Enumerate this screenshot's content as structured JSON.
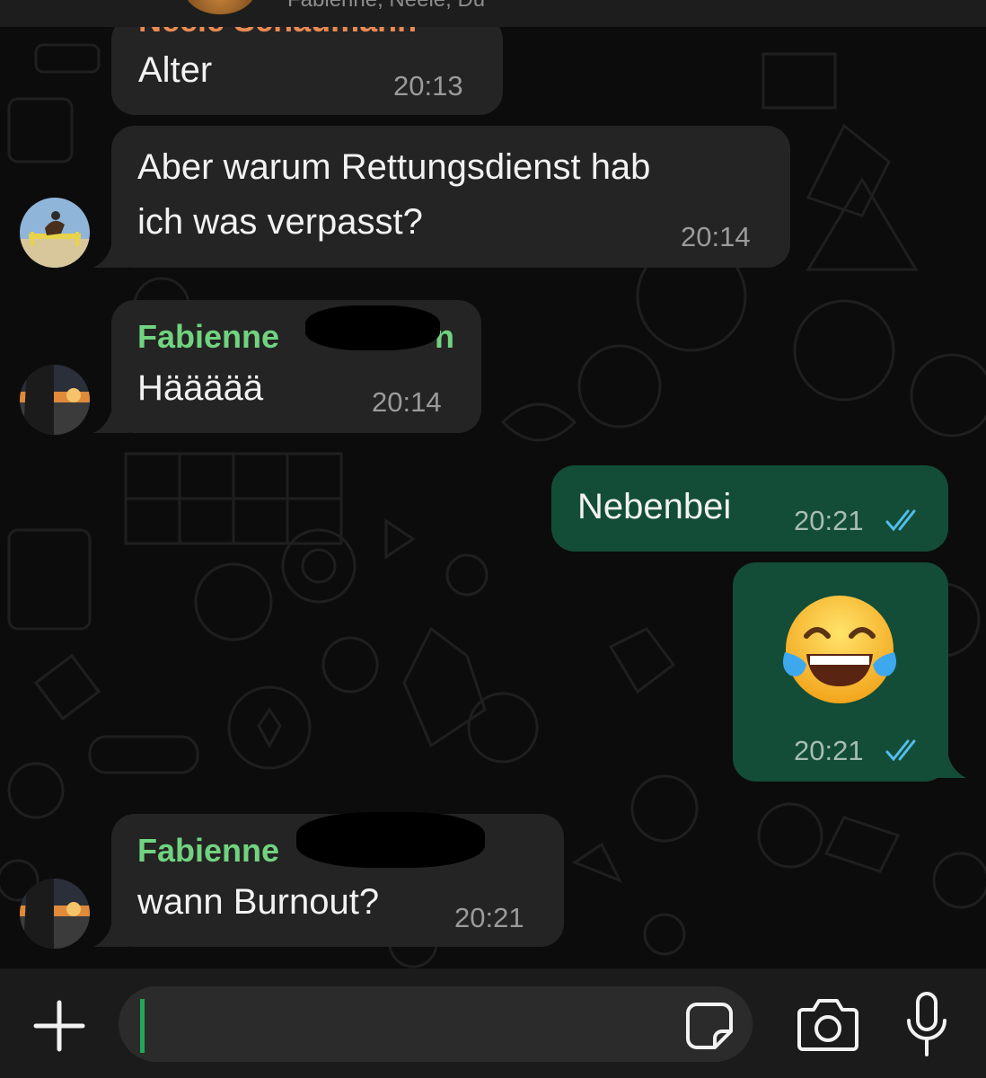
{
  "header": {
    "subtitle": "Fabienne, Neele, Du",
    "avatar_icon": "group-avatar-icon"
  },
  "messages": [
    {
      "direction": "incoming",
      "sender": "Neele Schaumann",
      "text": "Alter",
      "time": "20:13"
    },
    {
      "direction": "incoming",
      "text_line1": "Aber warum Rettungsdienst hab",
      "text_line2": "ich was verpasst?",
      "time": "20:14"
    },
    {
      "direction": "incoming",
      "sender": "Fabienne",
      "sender_tail": "n",
      "text": "Häääää",
      "time": "20:14"
    },
    {
      "direction": "outgoing",
      "text": "Nebenbei",
      "time": "20:21",
      "status": "read"
    },
    {
      "direction": "outgoing",
      "emoji": "😂",
      "emoji_name": "face-with-tears-of-joy",
      "time": "20:21",
      "status": "read"
    },
    {
      "direction": "incoming",
      "sender": "Fabienne",
      "text": "wann Burnout?",
      "time": "20:21"
    }
  ],
  "composer": {
    "value": "",
    "placeholder": "",
    "icons": [
      "plus-icon",
      "sticker-icon",
      "camera-icon",
      "microphone-icon"
    ]
  },
  "colors": {
    "background": "#0c0c0c",
    "incoming_bubble": "#242424",
    "outgoing_bubble": "#134d37",
    "sender_green": "#71d37f",
    "sender_orange": "#e98a54",
    "read_ticks": "#53bdeb",
    "cursor": "#1fa855"
  }
}
